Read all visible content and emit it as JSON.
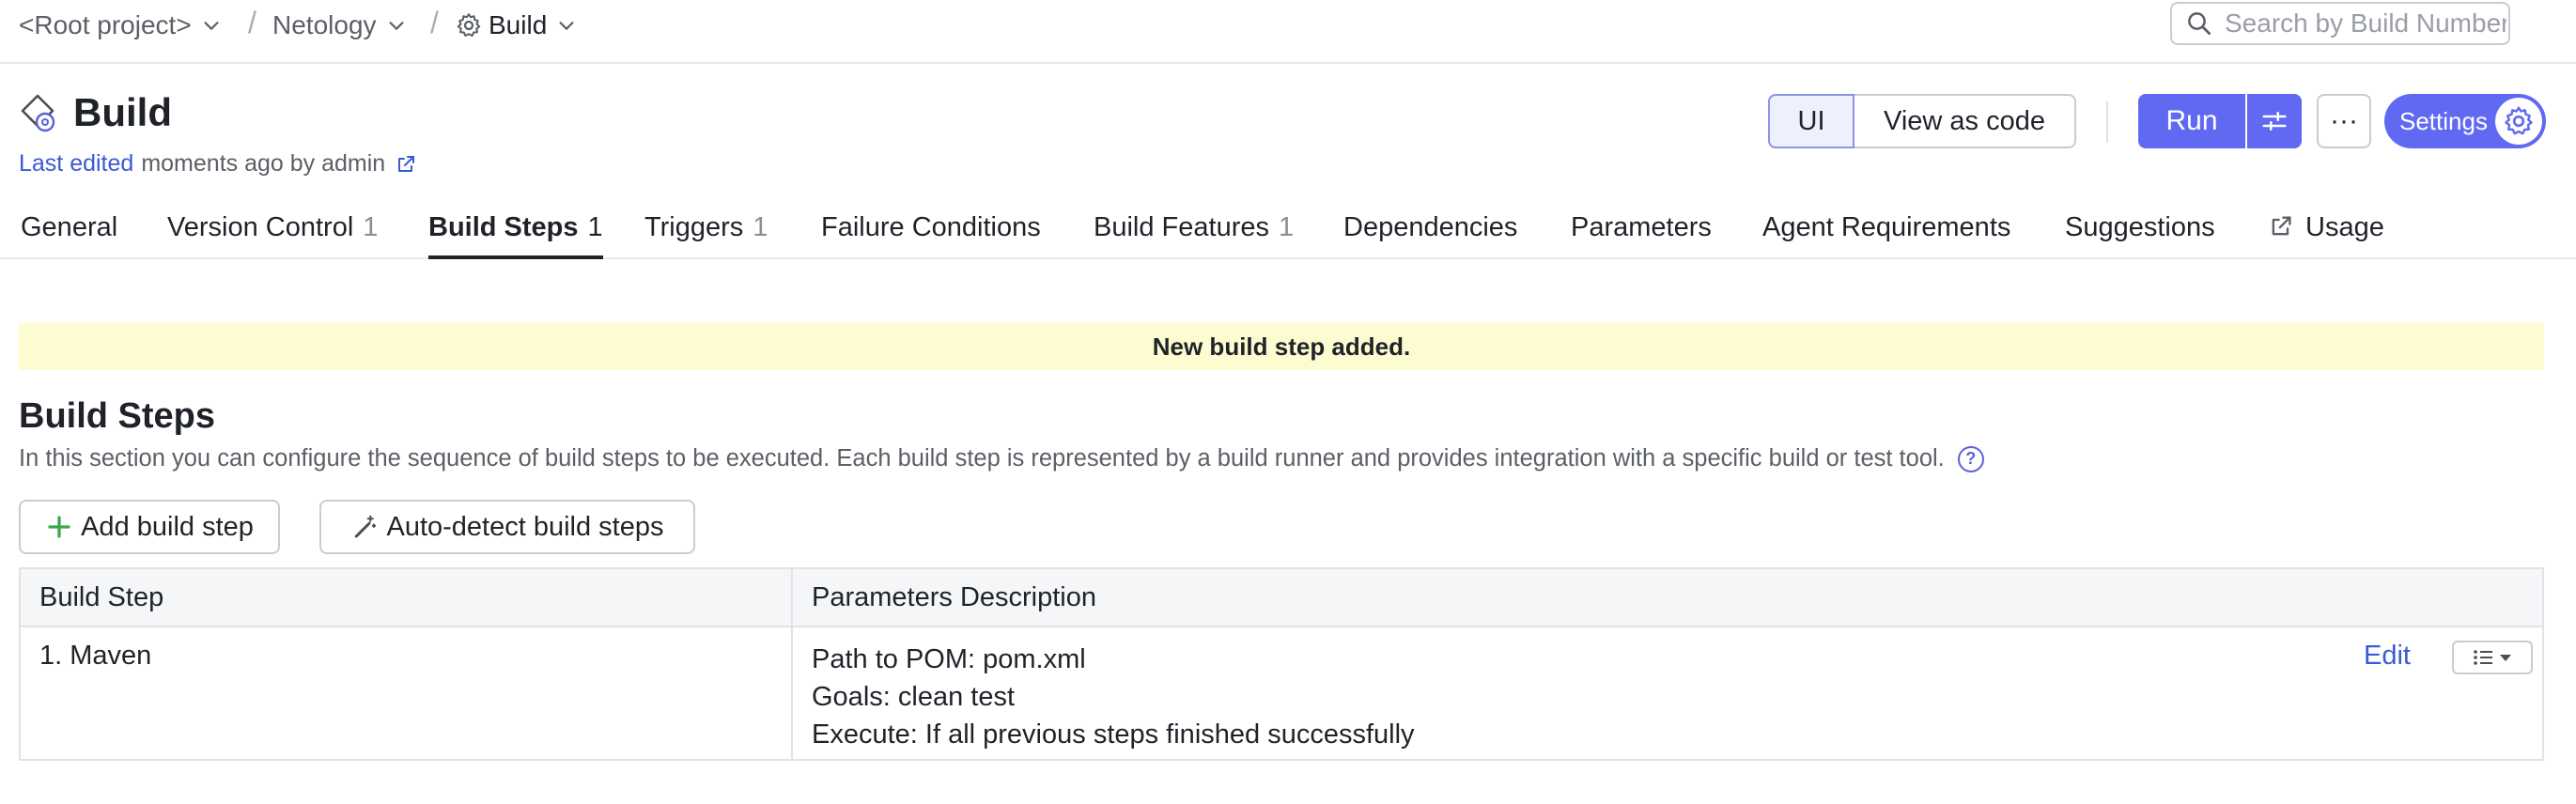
{
  "breadcrumb": {
    "root": "<Root project>",
    "project": "Netology",
    "config": "Build"
  },
  "search": {
    "placeholder": "Search by Build Number"
  },
  "header": {
    "title": "Build",
    "last_edited_link": "Last edited",
    "last_edited_rest": "moments ago by admin"
  },
  "toolbar": {
    "ui_label": "UI",
    "view_as_code_label": "View as code",
    "run_label": "Run",
    "more_label": "···",
    "settings_label": "Settings"
  },
  "tabs": [
    {
      "label": "General",
      "count": ""
    },
    {
      "label": "Version Control",
      "count": "1"
    },
    {
      "label": "Build Steps",
      "count": "1"
    },
    {
      "label": "Triggers",
      "count": "1"
    },
    {
      "label": "Failure Conditions",
      "count": ""
    },
    {
      "label": "Build Features",
      "count": "1"
    },
    {
      "label": "Dependencies",
      "count": ""
    },
    {
      "label": "Parameters",
      "count": ""
    },
    {
      "label": "Agent Requirements",
      "count": ""
    },
    {
      "label": "Suggestions",
      "count": ""
    },
    {
      "label": "Usage",
      "count": ""
    }
  ],
  "active_tab": "Build Steps",
  "banner": {
    "text": "New build step added."
  },
  "section": {
    "title": "Build Steps",
    "description": "In this section you can configure the sequence of build steps to be executed. Each build step is represented by a build runner and provides integration with a specific build or test tool.",
    "help": "?"
  },
  "actions": {
    "add_label": "Add build step",
    "autodetect_label": "Auto-detect build steps"
  },
  "table": {
    "headers": [
      "Build Step",
      "Parameters Description"
    ],
    "rows": [
      {
        "step": "1. Maven",
        "params": [
          "Path to POM: pom.xml",
          "Goals: clean test",
          "Execute: If all previous steps finished successfully"
        ],
        "edit_label": "Edit"
      }
    ]
  },
  "colors": {
    "accent": "#6169f2",
    "link": "#3a5ad6",
    "banner_bg": "#fdfcd0"
  }
}
